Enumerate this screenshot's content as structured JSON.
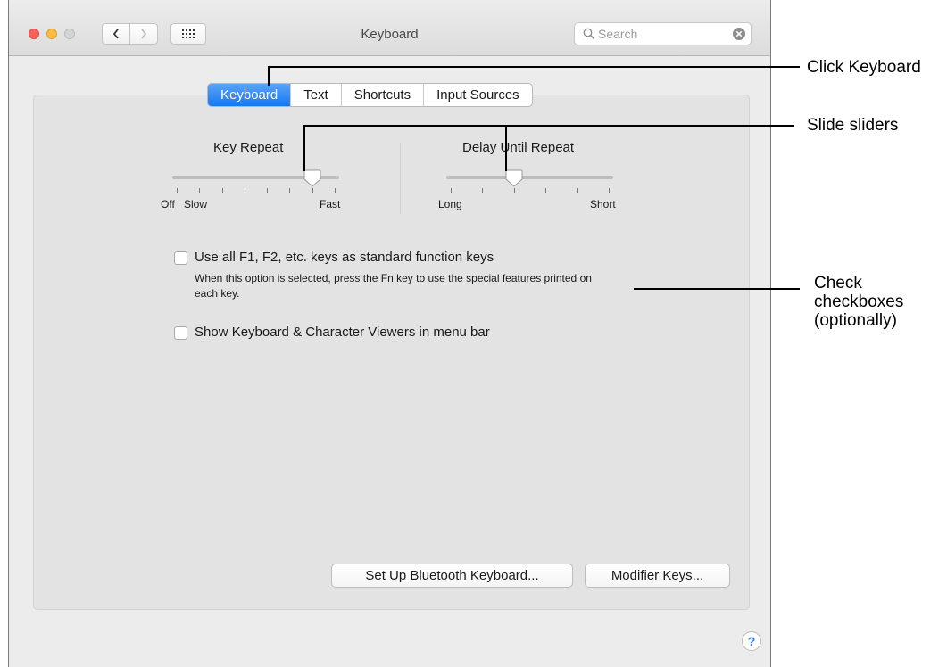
{
  "window": {
    "title": "Keyboard"
  },
  "toolbar": {
    "search_placeholder": "Search",
    "back_icon": "chevron-left-icon",
    "forward_icon": "chevron-right-icon",
    "grid_icon": "grid-icon"
  },
  "tabs": [
    {
      "label": "Keyboard",
      "active": true
    },
    {
      "label": "Text",
      "active": false
    },
    {
      "label": "Shortcuts",
      "active": false
    },
    {
      "label": "Input Sources",
      "active": false
    }
  ],
  "key_repeat": {
    "title": "Key Repeat",
    "label_left": "Off",
    "label_mid": "Slow",
    "label_right": "Fast",
    "tick_count": 8,
    "value_step": 6
  },
  "delay_until_repeat": {
    "title": "Delay Until Repeat",
    "label_left": "Long",
    "label_right": "Short",
    "tick_count": 6,
    "value_step": 2
  },
  "checkboxes": [
    {
      "label": "Use all F1, F2, etc. keys as standard function keys",
      "description": "When this option is selected, press the Fn key to use the special features printed on each key.",
      "checked": false
    },
    {
      "label": "Show Keyboard & Character Viewers in menu bar",
      "checked": false
    }
  ],
  "buttons": {
    "bluetooth": "Set Up Bluetooth Keyboard...",
    "modifier": "Modifier Keys...",
    "help": "?"
  },
  "callouts": {
    "click_keyboard": "Click Keyboard",
    "slide_sliders": "Slide sliders",
    "check_line1": "Check",
    "check_line2": "checkboxes",
    "check_line3": "(optionally)"
  },
  "colors": {
    "accent": "#1678f1",
    "close": "#fc605b",
    "minimize": "#fdbc40"
  }
}
